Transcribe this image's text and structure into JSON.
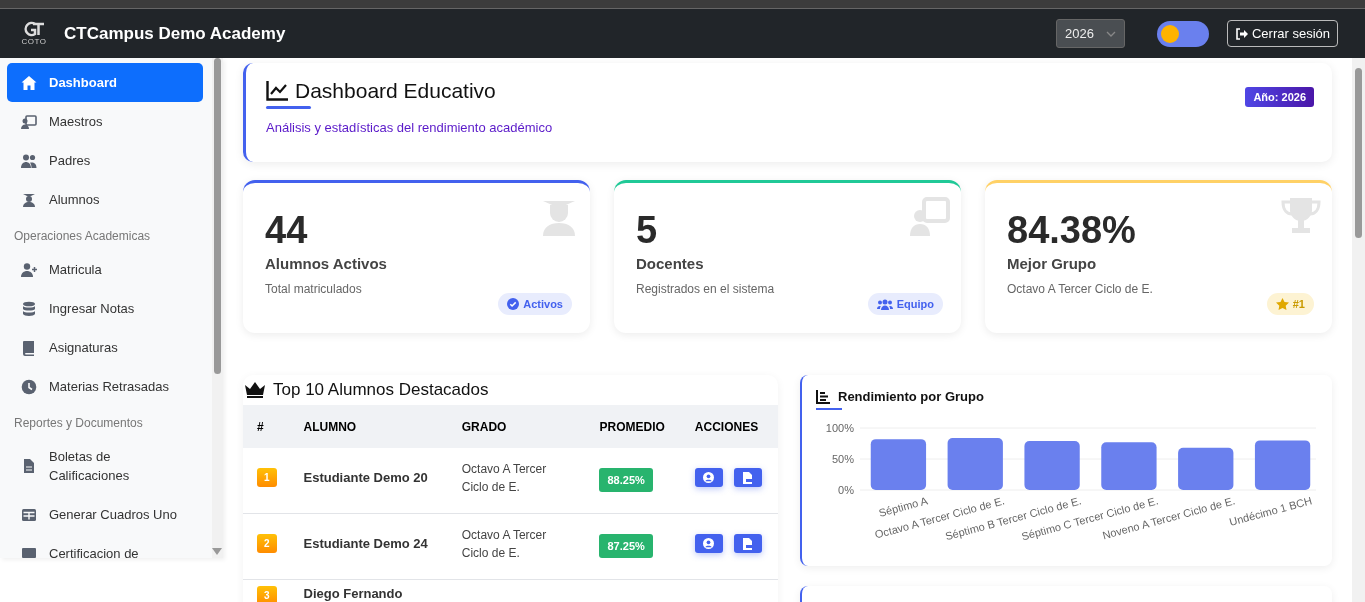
{
  "navbar": {
    "brand": "CTCampus Demo Academy",
    "logo_text": "COTO",
    "year_select": {
      "value": "2026"
    },
    "theme_toggle": {
      "on": false
    },
    "logout": "Cerrar sesión"
  },
  "sidebar": {
    "sections": [
      {
        "items": [
          {
            "label": "Dashboard",
            "selected": true
          },
          {
            "label": "Maestros",
            "selected": false
          },
          {
            "label": "Padres",
            "selected": false
          },
          {
            "label": "Alumnos",
            "selected": false
          }
        ]
      },
      {
        "heading": "Operaciones Academicas",
        "items": [
          {
            "label": "Matricula",
            "selected": false
          },
          {
            "label": "Ingresar Notas",
            "selected": false
          },
          {
            "label": "Asignaturas",
            "selected": false
          },
          {
            "label": "Materias Retrasadas",
            "selected": false
          }
        ]
      },
      {
        "heading": "Reportes y Documentos",
        "items": [
          {
            "label": "Boletas de Calificaciones",
            "selected": false
          },
          {
            "label": "Generar Cuadros Uno",
            "selected": false
          },
          {
            "label": "Certificacion de",
            "selected": false
          }
        ]
      }
    ]
  },
  "header": {
    "title": "Dashboard Educativo",
    "subtitle": "Análisis y estadísticas del rendimiento académico",
    "badge": "Año: 2026"
  },
  "stats": [
    {
      "value": "44",
      "label": "Alumnos Activos",
      "note": "Total matriculados",
      "badge": "Activos",
      "color": "#4361ee"
    },
    {
      "value": "5",
      "label": "Docentes",
      "note": "Registrados en el sistema",
      "badge": "Equipo",
      "color": "#20c997"
    },
    {
      "value": "84.38%",
      "label": "Mejor Grupo",
      "note": "Octavo A Tercer Ciclo de E.",
      "badge": "#1",
      "color": "#ffd166"
    }
  ],
  "top_students": {
    "title": "Top 10 Alumnos Destacados",
    "columns": [
      "#",
      "ALUMNO",
      "GRADO",
      "PROMEDIO",
      "ACCIONES"
    ],
    "rows": [
      {
        "rank": "1",
        "name": "Estudiante Demo 20",
        "grade": "Octavo A Tercer Ciclo de E.",
        "average": "88.25%"
      },
      {
        "rank": "2",
        "name": "Estudiante Demo 24",
        "grade": "Octavo A Tercer Ciclo de E.",
        "average": "87.25%"
      },
      {
        "rank": "3",
        "name": "Diego Fernando",
        "grade": "",
        "average": ""
      }
    ]
  },
  "performance": {
    "title": "Rendimiento por Grupo",
    "chart_data": {
      "type": "bar",
      "categories": [
        "Séptimo A",
        "Octavo A Tercer Ciclo de E.",
        "Séptimo B Tercer Ciclo de E.",
        "Séptimo C Tercer Ciclo de E.",
        "Noveno A Tercer Ciclo de E.",
        "Undécimo 1 BCH"
      ],
      "series": [
        {
          "color": "#6a80ee",
          "values": [
            82,
            84,
            79,
            77,
            68,
            80
          ]
        }
      ],
      "ylim": [
        0,
        100
      ],
      "yticks": [
        {
          "value": 0,
          "label": "0%"
        },
        {
          "value": 50,
          "label": "50%"
        },
        {
          "value": 100,
          "label": "100%"
        }
      ]
    }
  }
}
